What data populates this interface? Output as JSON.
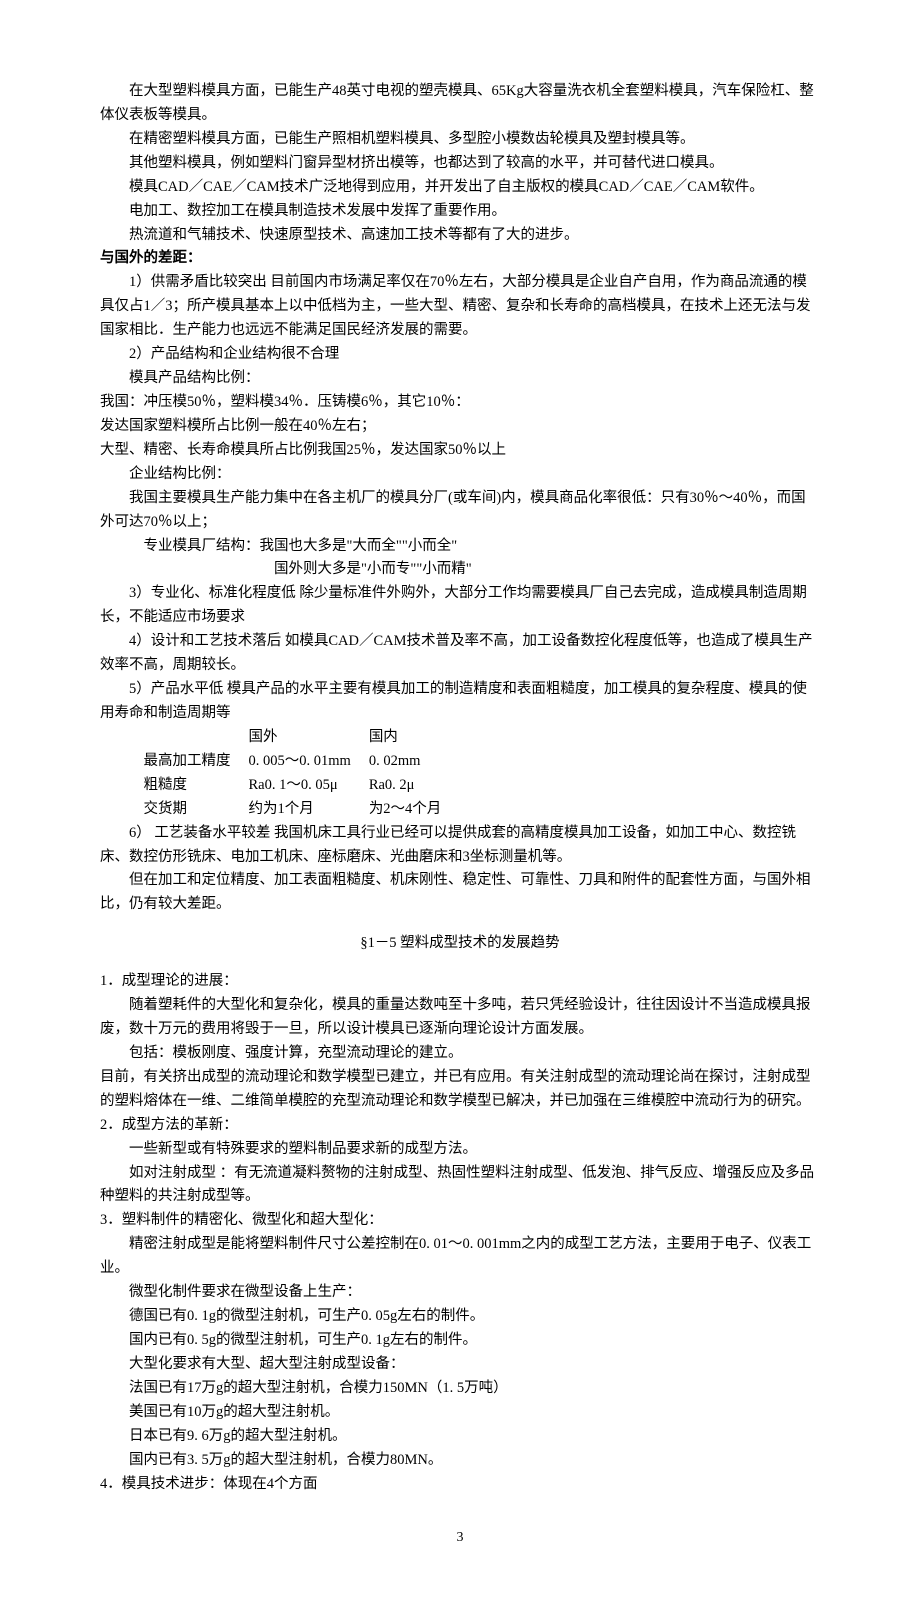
{
  "p1": "在大型塑料模具方面，已能生产48英寸电视的塑壳模具、65Kg大容量洗衣机全套塑料模具，汽车保险杠、整体仪表板等模具。",
  "p2": "在精密塑料模具方面，已能生产照相机塑料模具、多型腔小模数齿轮模具及塑封模具等。",
  "p3": "其他塑料模具，例如塑料门窗异型材挤出模等，也都达到了较高的水平，并可替代进口模具。",
  "p4": "模具CAD／CAE／CAM技术广泛地得到应用，并开发出了自主版权的模具CAD／CAE／CAM软件。",
  "p5": "电加工、数控加工在模具制造技术发展中发挥了重要作用。",
  "p6": "热流道和气辅技术、快速原型技术、高速加工技术等都有了大的进步。",
  "gap_h": "与国外的差距：",
  "g1": "1）供需矛盾比较突出  目前国内市场满足率仅在70％左右，大部分模具是企业自产自用，作为商品流通的模具仅占1／3；所产模具基本上以中低档为主，一些大型、精密、复杂和长寿命的高档模具，在技术上还无法与发国家相比．生产能力也远远不能满足国民经济发展的需要。",
  "g2": "2）产品结构和企业结构很不合理",
  "g2a": "模具产品结构比例：",
  "g2b": "我国：冲压模50％，塑料模34％．压铸模6％，其它10％：",
  "g2c": "发达国家塑料模所占比例一般在40％左右；",
  "g2d": "大型、精密、长寿命模具所占比例我国25％，发达国家50％以上",
  "g2e": "企业结构比例：",
  "g2f": "我国主要模具生产能力集中在各主机厂的模具分厂(或车间)内，模具商品化率很低：只有30％～40％，而国外可达70％以上；",
  "g2g": "专业模具厂结构：我国也大多是\"大而全\"\"小而全\"",
  "g2h": "国外则大多是\"小而专\"\"小而精\"",
  "g3": "3）专业化、标准化程度低  除少量标准件外购外，大部分工作均需要模具厂自己去完成，造成模具制造周期长，不能适应市场要求",
  "g4": "4）设计和工艺技术落后  如模具CAD／CAM技术普及率不高，加工设备数控化程度低等，也造成了模具生产效率不高，周期较长。",
  "g5": "5）产品水平低  模具产品的水平主要有模具加工的制造精度和表面粗糙度，加工模具的复杂程度、模具的使用寿命和制造周期等",
  "thdr": {
    "c1": "",
    "c2": "国外",
    "c3": "国内"
  },
  "tr1": {
    "c1": "最高加工精度",
    "c2": "0. 005～0. 01mm",
    "c3": "0. 02mm"
  },
  "tr2": {
    "c1": "粗糙度",
    "c2": "Ra0. 1～0. 05μ",
    "c3": "Ra0. 2μ"
  },
  "tr3": {
    "c1": "交货期",
    "c2": "约为1个月",
    "c3": "为2～4个月"
  },
  "g6": "6）  工艺装备水平较差  我国机床工具行业已经可以提供成套的高精度模具加工设备，如加工中心、数控铣床、数控仿形铣床、电加工机床、座标磨床、光曲磨床和3坐标测量机等。",
  "g6a": "但在加工和定位精度、加工表面粗糙度、机床刚性、稳定性、可靠性、刀具和附件的配套性方面，与国外相比，仍有较大差距。",
  "sec15": "§1－5    塑料成型技术的发展趋势",
  "s1h": "1．成型理论的进展：",
  "s1a": "随着塑耗件的大型化和复杂化，模具的重量达数吨至十多吨，若只凭经验设计，往往因设计不当造成模具报废，数十万元的费用将毁于一旦，所以设计模具已逐渐向理论设计方面发展。",
  "s1b": "包括：模板刚度、强度计算，充型流动理论的建立。",
  "s1c": "目前，有关挤出成型的流动理论和数学模型已建立，并已有应用。有关注射成型的流动理论尚在探讨，注射成型的塑料熔体在一维、二维简单模腔的充型流动理论和数学模型已解决，并已加强在三维模腔中流动行为的研究。",
  "s2h": "2．成型方法的革新：",
  "s2a": "一些新型或有特殊要求的塑料制品要求新的成型方法。",
  "s2b": "如对注射成型 ：有无流道凝料赘物的注射成型、热固性塑料注射成型、低发泡、排气反应、增强反应及多品种塑料的共注射成型等。",
  "s3h": "3．塑料制件的精密化、微型化和超大型化：",
  "s3a": "精密注射成型是能将塑料制件尺寸公差控制在0. 01～0. 001mm之内的成型工艺方法，主要用于电子、仪表工业。",
  "s3b": "微型化制件要求在微型设备上生产：",
  "s3c": "德国已有0. 1g的微型注射机，可生产0. 05g左右的制件。",
  "s3d": "国内已有0. 5g的微型注射机，可生产0. 1g左右的制件。",
  "s3e": "大型化要求有大型、超大型注射成型设备：",
  "s3f": "法国已有17万g的超大型注射机，合模力150MN（1. 5万吨）",
  "s3g": "美国已有10万g的超大型注射机。",
  "s3h2": "日本已有9. 6万g的超大型注射机。",
  "s3i": "国内已有3. 5万g的超大型注射机，合模力80MN。",
  "s4h": "4．模具技术进步：体现在4个方面",
  "pagenum": "3"
}
